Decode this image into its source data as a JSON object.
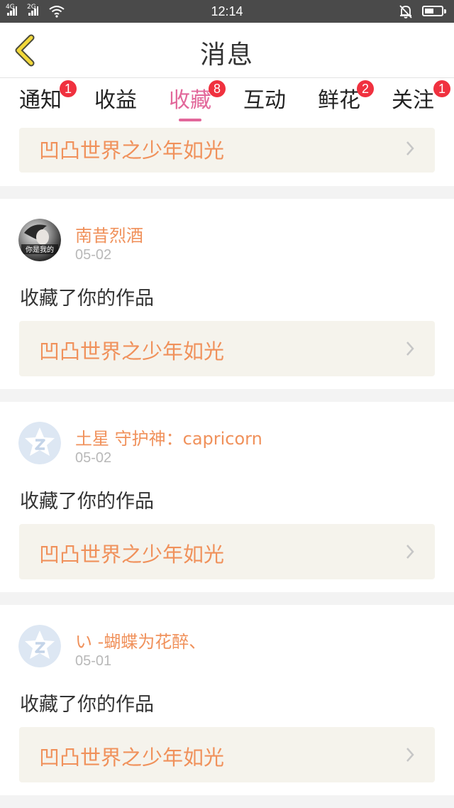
{
  "status_bar": {
    "signal1_label": "4G",
    "signal2_label": "2G",
    "time": "12:14"
  },
  "header": {
    "title": "消息"
  },
  "tabs": [
    {
      "label": "通知",
      "badge": "1",
      "active": false
    },
    {
      "label": "收益",
      "badge": "",
      "active": false
    },
    {
      "label": "收藏",
      "badge": "8",
      "active": true
    },
    {
      "label": "互动",
      "badge": "",
      "active": false
    },
    {
      "label": "鲜花",
      "badge": "2",
      "active": false
    },
    {
      "label": "关注",
      "badge": "1",
      "active": false
    }
  ],
  "feed": {
    "partial_work_title": "凹凸世界之少年如光",
    "items": [
      {
        "username": "南昔烈酒",
        "date": "05-02",
        "action": "收藏了你的作品",
        "work_title": "凹凸世界之少年如光",
        "avatar": "photo-avatar",
        "avatar_caption": "你是我的"
      },
      {
        "username": "土星 守护神：capricorn",
        "date": "05-02",
        "action": "收藏了你的作品",
        "work_title": "凹凸世界之少年如光",
        "avatar": "default-star-avatar"
      },
      {
        "username": "い -蝴蝶为花醉、",
        "date": "05-01",
        "action": "收藏了你的作品",
        "work_title": "凹凸世界之少年如光",
        "avatar": "default-star-avatar"
      }
    ]
  },
  "colors": {
    "accent_pink": "#e2679a",
    "orange_text": "#f0915b",
    "badge_red": "#f0313f",
    "back_arrow_yellow": "#f2d83a",
    "work_box_bg": "#f5f3ec"
  }
}
